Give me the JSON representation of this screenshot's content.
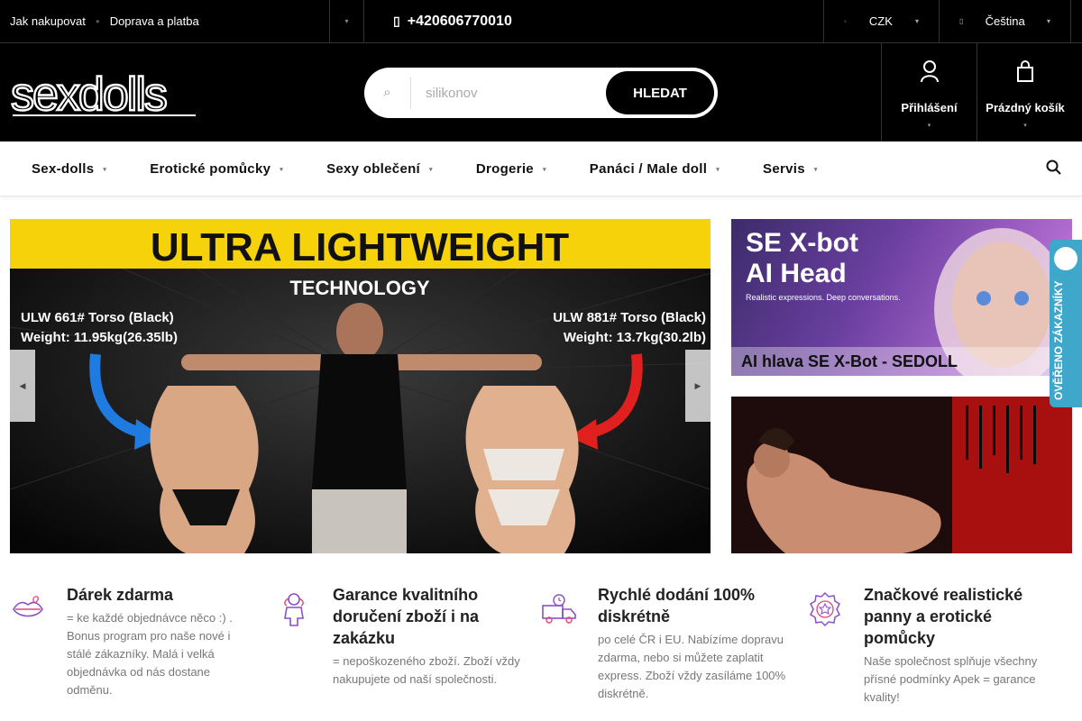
{
  "topbar": {
    "links": [
      "Jak nakupovat",
      "Doprava a platba"
    ],
    "phone": "+420606770010",
    "currency": "CZK",
    "language": "Čeština"
  },
  "header": {
    "logo_text": "sexdolls",
    "search": {
      "placeholder": "silikonov",
      "button_label": "HLEDAT"
    },
    "login_label": "Přihlášení",
    "cart_label": "Prázdný košík"
  },
  "nav": {
    "items": [
      "Sex-dolls",
      "Erotické pomůcky",
      "Sexy oblečení",
      "Drogerie",
      "Panáci / Male doll",
      "Servis"
    ]
  },
  "banner": {
    "title": "ULTRA LIGHTWEIGHT",
    "subtitle": "TECHNOLOGY",
    "left_product": "ULW 661# Torso (Black)",
    "left_weight": "Weight: 11.95kg(26.35lb)",
    "right_product": "ULW 881# Torso (Black)",
    "right_weight": "Weight: 13.7kg(30.2lb)"
  },
  "side_banners": {
    "first_heading_1": "SE X-bot",
    "first_heading_2": "AI Head",
    "first_tagline": "Realistic expressions. Deep conversations.",
    "first_caption": "AI hlava SE X-Bot - SEDOLL"
  },
  "verified_badge": {
    "label": "OVĚŘENO ZÁKAZNÍKY"
  },
  "features": [
    {
      "title": "Dárek zdarma",
      "text": "= ke každé objednávce něco :) . Bonus program pro naše nové i stálé zákazníky. Malá i velká objednávka od nás dostane odměnu.",
      "icon": "lips-icon"
    },
    {
      "title": "Garance kvalitního doručení zboží i na zakázku",
      "text": "= nepoškozeného zboží. Zboží vždy nakupujete od naší společnosti.",
      "icon": "doll-icon"
    },
    {
      "title": "Rychlé dodání 100% diskrétně",
      "text": "po celé ČR i EU. Nabízíme dopravu zdarma, nebo si můžete zaplatit express. Zboží vždy zasíláme 100% diskrétně.",
      "icon": "delivery-truck-icon"
    },
    {
      "title": "Značkové realistické panny a erotické pomůcky",
      "text": "Naše společnost splňuje všechny přísné podmínky Apek = garance kvality!",
      "icon": "quality-badge-icon"
    }
  ],
  "colors": {
    "header_bg": "#000000",
    "icon_accent": "#8a4fc9",
    "verified_bg": "#3fa7c9",
    "banner_yellow": "#f5d20a"
  }
}
